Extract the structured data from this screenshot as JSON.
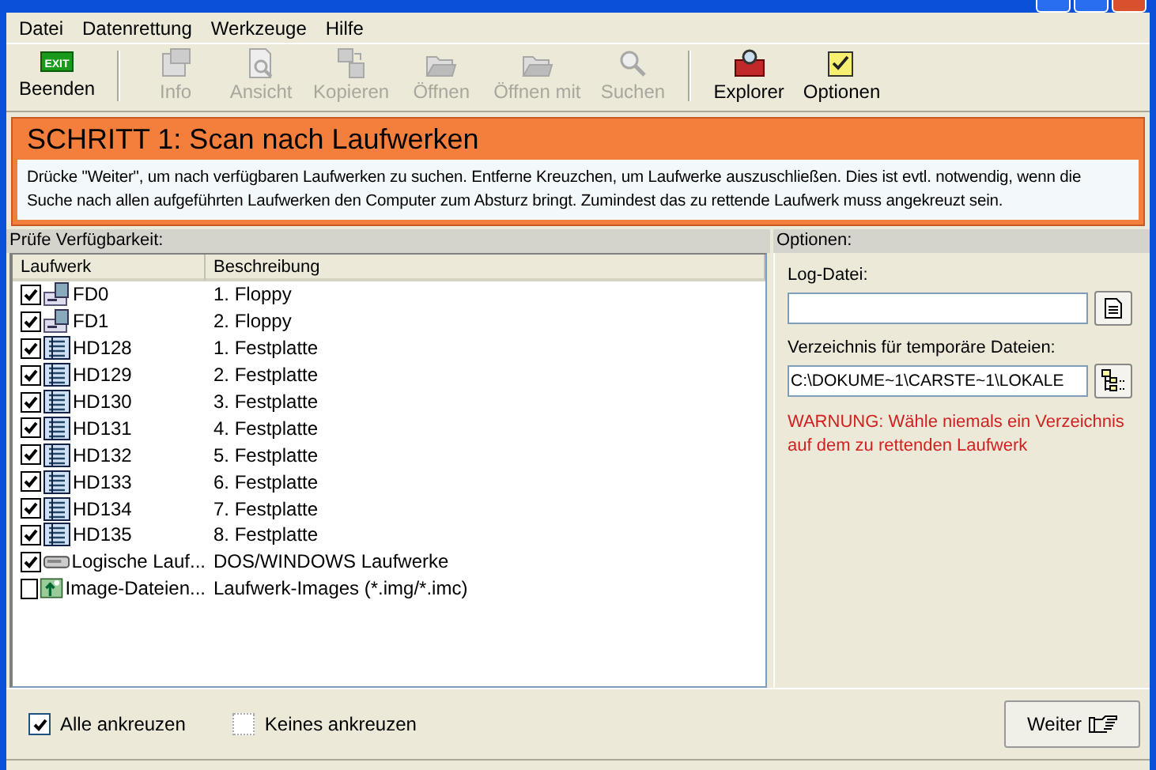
{
  "menu": [
    "Datei",
    "Datenrettung",
    "Werkzeuge",
    "Hilfe"
  ],
  "toolbar": [
    {
      "label": "Beenden",
      "kind": "exit",
      "disabled": false,
      "icon_text": "EXIT"
    },
    {
      "label": "Info",
      "kind": "info",
      "disabled": true
    },
    {
      "label": "Ansicht",
      "kind": "view",
      "disabled": true
    },
    {
      "label": "Kopieren",
      "kind": "copy",
      "disabled": true
    },
    {
      "label": "Öffnen",
      "kind": "open",
      "disabled": true
    },
    {
      "label": "Öffnen mit",
      "kind": "open",
      "disabled": true
    },
    {
      "label": "Suchen",
      "kind": "search",
      "disabled": true
    },
    {
      "label": "Explorer",
      "kind": "explorer",
      "disabled": false
    },
    {
      "label": "Optionen",
      "kind": "options",
      "disabled": false
    }
  ],
  "step": {
    "title": "SCHRITT 1: Scan nach Laufwerken",
    "text": "Drücke \"Weiter\", um nach verfügbaren Laufwerken zu suchen. Entferne Kreuzchen, um Laufwerke auszuschließen. Dies ist evtl. notwendig, wenn die Suche nach allen aufgeführten Laufwerken den Computer zum Absturz bringt. Zumindest das zu rettende Laufwerk muss angekreuzt sein."
  },
  "drives": {
    "title": "Prüfe Verfügbarkeit:",
    "columns": [
      "Laufwerk",
      "Beschreibung"
    ],
    "rows": [
      {
        "kind": "floppy",
        "name": "FD0",
        "description": "1. Floppy",
        "checked": true
      },
      {
        "kind": "floppy",
        "name": "FD1",
        "description": "2. Floppy",
        "checked": true
      },
      {
        "kind": "disk",
        "name": "HD128",
        "description": "1. Festplatte",
        "checked": true
      },
      {
        "kind": "disk",
        "name": "HD129",
        "description": "2. Festplatte",
        "checked": true
      },
      {
        "kind": "disk",
        "name": "HD130",
        "description": "3. Festplatte",
        "checked": true
      },
      {
        "kind": "disk",
        "name": "HD131",
        "description": "4. Festplatte",
        "checked": true
      },
      {
        "kind": "disk",
        "name": "HD132",
        "description": "5. Festplatte",
        "checked": true
      },
      {
        "kind": "disk",
        "name": "HD133",
        "description": "6. Festplatte",
        "checked": true
      },
      {
        "kind": "disk",
        "name": "HD134",
        "description": "7. Festplatte",
        "checked": true
      },
      {
        "kind": "disk",
        "name": "HD135",
        "description": "8. Festplatte",
        "checked": true
      },
      {
        "kind": "logical",
        "name": "Logische Lauf...",
        "description": "DOS/WINDOWS Laufwerke",
        "checked": true
      },
      {
        "kind": "image",
        "name": "Image-Dateien...",
        "description": "Laufwerk-Images (*.img/*.imc)",
        "checked": false
      }
    ]
  },
  "options": {
    "title": "Optionen:",
    "log_label": "Log-Datei:",
    "temp_label": "Verzeichnis für temporäre Dateien:",
    "temp_value": "C:\\DOKUME~1\\CARSTE~1\\LOKALE",
    "warning": "WARNUNG: Wähle niemals ein Verzeichnis auf dem zu rettenden Laufwerk"
  },
  "bottom": {
    "checks": [
      {
        "label": "Alle ankreuzen",
        "checked": true,
        "disabled": false
      },
      {
        "label": "Keines ankreuzen",
        "checked": false,
        "disabled": true
      }
    ],
    "next": "Weiter"
  }
}
